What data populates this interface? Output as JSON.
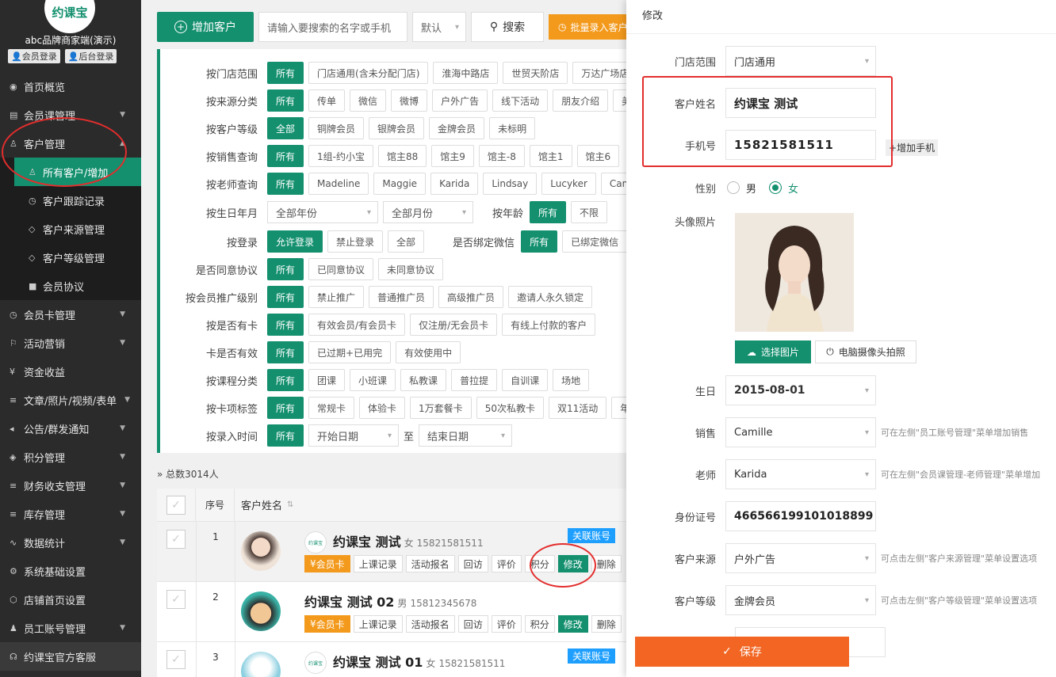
{
  "sidebar": {
    "logo_text": "约课宝",
    "brand": "abc品牌商家端(演示)",
    "member_login": "会员登录",
    "admin_login": "后台登录",
    "items": [
      {
        "label": "首页概览"
      },
      {
        "label": "会员课管理"
      },
      {
        "label": "客户管理"
      },
      {
        "label": "所有客户/增加"
      },
      {
        "label": "客户跟踪记录"
      },
      {
        "label": "客户来源管理"
      },
      {
        "label": "客户等级管理"
      },
      {
        "label": "会员协议"
      },
      {
        "label": "会员卡管理"
      },
      {
        "label": "活动营销"
      },
      {
        "label": "资金收益"
      },
      {
        "label": "文章/照片/视频/表单"
      },
      {
        "label": "公告/群发通知"
      },
      {
        "label": "积分管理"
      },
      {
        "label": "财务收支管理"
      },
      {
        "label": "库存管理"
      },
      {
        "label": "数据统计"
      },
      {
        "label": "系统基础设置"
      },
      {
        "label": "店铺首页设置"
      },
      {
        "label": "员工账号管理"
      },
      {
        "label": "约课宝官方客服"
      }
    ]
  },
  "toolbar": {
    "add_label": "增加客户",
    "search_placeholder": "请输入要搜索的名字或手机",
    "default_select": "默认",
    "search_label": "搜索",
    "batch_label": "批量录入客户"
  },
  "filters": {
    "store": {
      "label": "按门店范围",
      "chips": [
        "所有",
        "门店通用(含未分配门店)",
        "淮海中路店",
        "世贸天阶店",
        "万达广场店"
      ]
    },
    "source": {
      "label": "按来源分类",
      "chips": [
        "所有",
        "传单",
        "微信",
        "微博",
        "户外广告",
        "线下活动",
        "朋友介绍",
        "美"
      ]
    },
    "level": {
      "label": "按客户等级",
      "chips": [
        "全部",
        "铜牌会员",
        "银牌会员",
        "金牌会员",
        "未标明"
      ]
    },
    "sales": {
      "label": "按销售查询",
      "chips": [
        "所有",
        "1组-约小宝",
        "馆主88",
        "馆主9",
        "馆主-8",
        "馆主1",
        "馆主6"
      ]
    },
    "teacher": {
      "label": "按老师查询",
      "chips": [
        "所有",
        "Madeline",
        "Maggie",
        "Karida",
        "Lindsay",
        "Lucyker",
        "Camille"
      ]
    },
    "birthday": {
      "label": "按生日年月",
      "year": "全部年份",
      "month": "全部月份",
      "age_label": "按年龄",
      "age_chips": [
        "所有",
        "不限"
      ]
    },
    "login": {
      "label": "按登录",
      "chips": [
        "允许登录",
        "禁止登录",
        "全部"
      ],
      "wechat_label": "是否绑定微信",
      "wechat_chips": [
        "所有",
        "已绑定微信"
      ]
    },
    "agree": {
      "label": "是否同意协议",
      "chips": [
        "所有",
        "已同意协议",
        "未同意协议"
      ]
    },
    "promo": {
      "label": "按会员推广级别",
      "chips": [
        "所有",
        "禁止推广",
        "普通推广员",
        "高级推广员",
        "邀请人永久锁定"
      ]
    },
    "hascard": {
      "label": "按是否有卡",
      "chips": [
        "所有",
        "有效会员/有会员卡",
        "仅注册/无会员卡",
        "有线上付款的客户"
      ]
    },
    "valid": {
      "label": "卡是否有效",
      "chips": [
        "所有",
        "已过期+已用完",
        "有效使用中"
      ]
    },
    "course": {
      "label": "按课程分类",
      "chips": [
        "所有",
        "团课",
        "小班课",
        "私教课",
        "普拉提",
        "自训课",
        "场地"
      ]
    },
    "tag": {
      "label": "按卡项标签",
      "chips": [
        "所有",
        "常规卡",
        "体验卡",
        "1万套餐卡",
        "50次私教卡",
        "双11活动",
        "年"
      ]
    },
    "entry": {
      "label": "按录入时间",
      "chips": [
        "所有"
      ],
      "start": "开始日期",
      "to": "至",
      "end": "结束日期"
    }
  },
  "total": "总数3014人",
  "table": {
    "col_no": "序号",
    "col_name": "客户姓名",
    "rows": [
      {
        "no": "1",
        "name": "约课宝 测试",
        "gender": "女",
        "phone": "15821581511",
        "tag": "关联账号",
        "logo": "约课宝"
      },
      {
        "no": "2",
        "name": "约课宝 测试 02",
        "gender": "男",
        "phone": "15812345678",
        "tag": "",
        "logo": ""
      },
      {
        "no": "3",
        "name": "约课宝 测试 01",
        "gender": "女",
        "phone": "15821581511",
        "tag": "关联账号",
        "logo": "约课宝"
      }
    ],
    "actions": {
      "card": "会员卡",
      "record": "上课记录",
      "event": "活动报名",
      "visit": "回访",
      "rate": "评价",
      "points": "积分",
      "edit": "修改",
      "delete": "删除"
    }
  },
  "panel": {
    "title": "修改",
    "store_label": "门店范围",
    "store_value": "门店通用",
    "name_label": "客户姓名",
    "name_value": "约课宝 测试",
    "phone_label": "手机号",
    "phone_value": "15821581511",
    "add_phone": "增加手机",
    "gender_label": "性别",
    "male": "男",
    "female": "女",
    "gender_selected": "女",
    "photo_label": "头像照片",
    "choose_photo": "选择图片",
    "camera_photo": "电脑摄像头拍照",
    "birthday_label": "生日",
    "birthday_value": "2015-08-01",
    "sales_label": "销售",
    "sales_value": "Camille",
    "sales_hint": "可在左侧\"员工账号管理\"菜单增加销售",
    "teacher_label": "老师",
    "teacher_value": "Karida",
    "teacher_hint": "可在左侧\"会员课管理-老师管理\"菜单增加",
    "id_label": "身份证号",
    "id_value": "466566199101018899",
    "source_label": "客户来源",
    "source_value": "户外广告",
    "source_hint": "可点击左侧\"客户来源管理\"菜单设置选项",
    "level_label": "客户等级",
    "level_value": "金牌会员",
    "level_hint": "可点击左侧\"客户等级管理\"菜单设置选项",
    "save_label": "保存"
  },
  "colors": {
    "accent": "#14906f",
    "orange": "#f39a1d",
    "save": "#f26522",
    "annotation": "#e32d2d"
  }
}
